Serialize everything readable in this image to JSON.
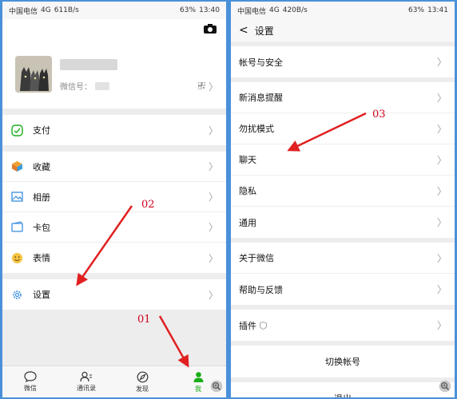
{
  "left": {
    "status": {
      "carrier": "中国电信",
      "signal": "4G",
      "speed": "611B/s",
      "battery": "63%",
      "time": "13:40"
    },
    "profile": {
      "wechat_id_label": "微信号："
    },
    "groups": [
      [
        {
          "label": "支付",
          "icon": "wechat-pay-icon"
        }
      ],
      [
        {
          "label": "收藏",
          "icon": "favorites-box-icon"
        },
        {
          "label": "相册",
          "icon": "album-image-icon"
        },
        {
          "label": "卡包",
          "icon": "card-wallet-icon"
        },
        {
          "label": "表情",
          "icon": "smiley-icon"
        }
      ],
      [
        {
          "label": "设置",
          "icon": "gear-icon"
        }
      ]
    ],
    "tabs": [
      {
        "label": "微信",
        "icon": "chat-bubble-icon"
      },
      {
        "label": "通讯录",
        "icon": "contacts-icon"
      },
      {
        "label": "发现",
        "icon": "compass-icon"
      },
      {
        "label": "我",
        "icon": "person-icon"
      }
    ]
  },
  "right": {
    "status": {
      "carrier": "中国电信",
      "signal": "4G",
      "speed": "420B/s",
      "battery": "63%",
      "time": "13:41"
    },
    "title": "设置",
    "groups": [
      [
        {
          "label": "帐号与安全"
        }
      ],
      [
        {
          "label": "新消息提醒"
        },
        {
          "label": "勿扰模式"
        },
        {
          "label": "聊天"
        },
        {
          "label": "隐私"
        },
        {
          "label": "通用"
        }
      ],
      [
        {
          "label": "关于微信"
        },
        {
          "label": "帮助与反馈"
        }
      ],
      [
        {
          "label": "插件"
        }
      ]
    ],
    "switch_account": "切换帐号",
    "logout": "退出"
  },
  "annotations": {
    "a01": "01",
    "a02": "02",
    "a03": "03"
  },
  "colors": {
    "wechat_green": "#1aad19",
    "annotation_red": "#d0021b",
    "frame_blue": "#4a90d9"
  }
}
